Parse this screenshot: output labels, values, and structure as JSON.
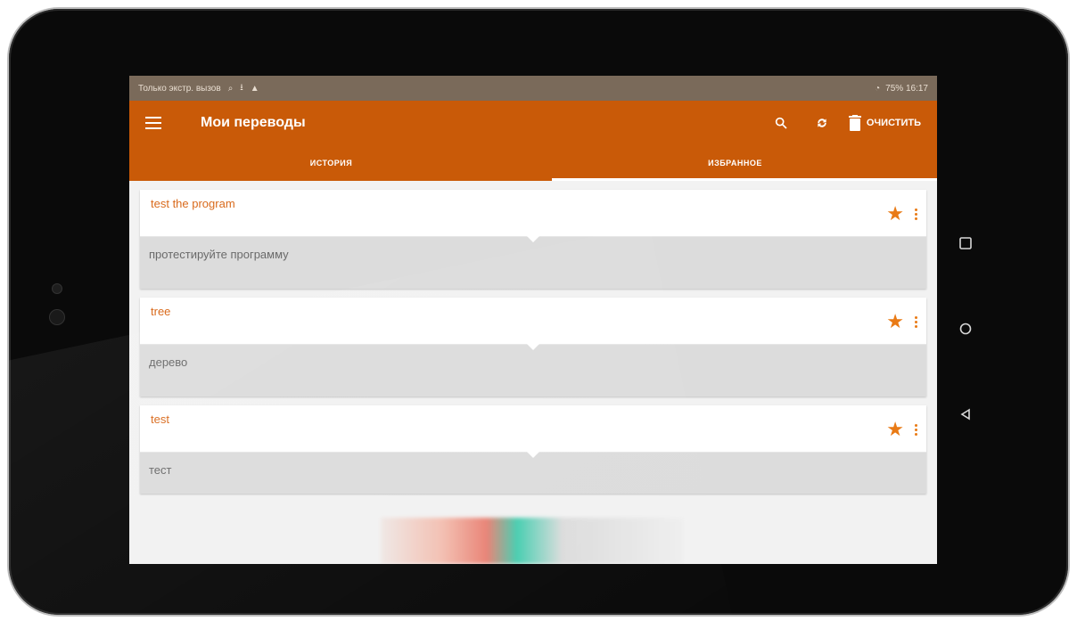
{
  "status_bar": {
    "left_text": "Только экстр. вызов",
    "right_text": "75% 16:17"
  },
  "app_bar": {
    "title": "Мои переводы",
    "clear_label": "ОЧИСТИТЬ"
  },
  "tabs": [
    {
      "label": "ИСТОРИЯ",
      "selected": false
    },
    {
      "label": "ИЗБРАННОЕ",
      "selected": true
    }
  ],
  "items": [
    {
      "source": "test the program",
      "translation": "протестируйте программу",
      "starred": true
    },
    {
      "source": "tree",
      "translation": "дерево",
      "starred": true
    },
    {
      "source": "test",
      "translation": "тест",
      "starred": true
    }
  ],
  "icons": {
    "menu": "hamburger-icon",
    "search": "search-icon",
    "sync": "sync-icon",
    "clear": "trash-icon",
    "star": "star-icon",
    "more": "more-vert-icon"
  },
  "colors": {
    "accent": "#c95a08",
    "star": "#e97a15",
    "source_text": "#d96a1c"
  }
}
